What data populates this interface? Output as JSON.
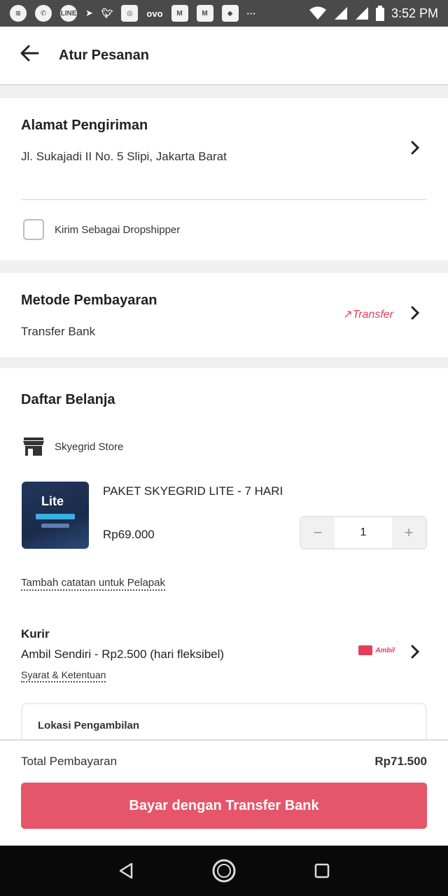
{
  "status_bar": {
    "time": "3:52 PM",
    "icons": [
      "spotify-icon",
      "whatsapp-icon",
      "line-icon",
      "navigation-icon",
      "twitter-icon",
      "instagram-icon",
      "ovo-icon",
      "gmail-icon",
      "gmail-icon",
      "maps-icon",
      "more-icon"
    ],
    "ovo_text": "ovo",
    "line_text": "LINE",
    "more_text": "···"
  },
  "header": {
    "title": "Atur Pesanan"
  },
  "address": {
    "title": "Alamat Pengiriman",
    "text": "Jl. Sukajadi II No. 5 Slipi, Jakarta Barat",
    "dropshipper_label": "Kirim Sebagai Dropshipper",
    "dropshipper_checked": false
  },
  "payment": {
    "title": "Metode Pembayaran",
    "method": "Transfer Bank",
    "logo_text": "↗Transfer"
  },
  "shopping": {
    "title": "Daftar Belanja",
    "store": "Skyegrid Store",
    "product": {
      "name": "PAKET SKYEGRID LITE - 7 HARI",
      "price": "Rp69.000",
      "quantity": "1",
      "thumb_text": "Lite"
    },
    "note_link": "Tambah catatan untuk Pelapak",
    "courier": {
      "title": "Kurir",
      "text": "Ambil Sendiri - Rp2.500 (hari fleksibel)",
      "terms": "Syarat & Ketentuan",
      "logo_text": "Ambil"
    },
    "pickup_title": "Lokasi Pengambilan"
  },
  "footer": {
    "total_label": "Total Pembayaran",
    "total_value": "Rp71.500",
    "pay_button": "Bayar dengan Transfer Bank"
  },
  "colors": {
    "accent": "#e5566a",
    "brand_pink": "#e0405a",
    "status_bar": "#4a4a4a"
  }
}
